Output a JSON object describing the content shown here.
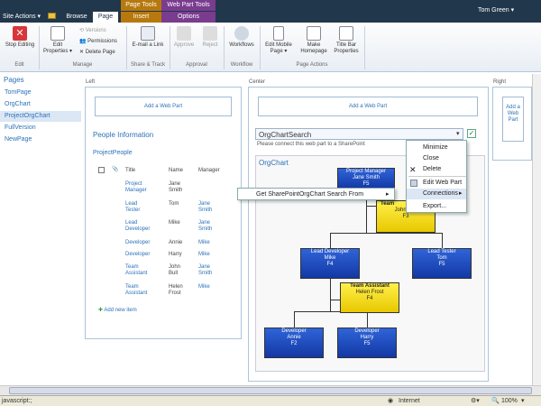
{
  "topbar": {
    "site_actions": "Site Actions ▾",
    "tabs": [
      "Browse",
      "Page",
      "Insert",
      "Options"
    ],
    "context_page_tools": "Page Tools",
    "context_web_part_tools": "Web Part Tools",
    "user": "Tom Green ▾"
  },
  "ribbon": {
    "stop_editing": "Stop Editing",
    "edit_properties": "Edit Properties ▾",
    "versions": "Versions",
    "permissions": "Permissions",
    "delete_page": "Delete Page",
    "email_link": "E-mail a Link",
    "approve": "Approve",
    "reject": "Reject",
    "workflows": "Workflows",
    "edit_mobile_page": "Edit Mobile Page ▾",
    "make_homepage": "Make Homepage",
    "title_bar_properties": "Title Bar Properties",
    "groups": [
      "Edit",
      "Manage",
      "Share & Track",
      "Approval",
      "Workflow",
      "Page Actions"
    ]
  },
  "nav": {
    "header": "Pages",
    "items": [
      "TomPage",
      "OrgChart",
      "ProjectOrgChart",
      "FullVersion",
      "NewPage"
    ]
  },
  "zones": {
    "left": "Left",
    "center": "Center",
    "right": "Right",
    "add_web_part": "Add a Web Part",
    "right_add": "Add a Web Part"
  },
  "people": {
    "title": "People Information",
    "list_title": "ProjectPeople",
    "col_title": "Title",
    "col_name": "Name",
    "col_manager": "Manager",
    "rows": [
      {
        "title": "Project Manager",
        "name": "Jane Smith",
        "manager": ""
      },
      {
        "title": "Lead Tester",
        "name": "Tom",
        "manager": "Jane Smith"
      },
      {
        "title": "Lead Developer",
        "name": "Mike",
        "manager": "Jane Smith"
      },
      {
        "title": "Developer",
        "name": "Annie",
        "manager": "Mike"
      },
      {
        "title": "Developer",
        "name": "Harry",
        "manager": "Mike"
      },
      {
        "title": "Team Assistant",
        "name": "John Bull",
        "manager": "Jane Smith"
      },
      {
        "title": "Team Assistant",
        "name": "Helen Frost",
        "manager": "Mike"
      }
    ],
    "add_item": "Add new item"
  },
  "search": {
    "title": "OrgChartSearch",
    "message": "Please connect this web part to a SharePoint"
  },
  "orgchart": {
    "title": "OrgChart",
    "nodes": {
      "pm": {
        "title": "Project Manager",
        "name": "Jane Smith",
        "id": "F5"
      },
      "ta1": {
        "title": "Team",
        "name": "John Bull",
        "id": "F3"
      },
      "ld": {
        "title": "Lead Developer",
        "name": "Mike",
        "id": "F4"
      },
      "lt": {
        "title": "Lead Tester",
        "name": "Tom",
        "id": "F5"
      },
      "ta2": {
        "title": "Team Assistant",
        "name": "Helen Frost",
        "id": "F4"
      },
      "dev1": {
        "title": "Developer",
        "name": "Annie",
        "id": "F2"
      },
      "dev2": {
        "title": "Developer",
        "name": "Harry",
        "id": "F5"
      }
    }
  },
  "menu": {
    "items": [
      "Minimize",
      "Close",
      "Delete",
      "Edit Web Part",
      "Connections",
      "Export..."
    ],
    "submenu": "Get SharePointOrgChart Search From"
  },
  "status": {
    "left": "javascript:;",
    "zone": "Internet",
    "zoom": "100%"
  }
}
